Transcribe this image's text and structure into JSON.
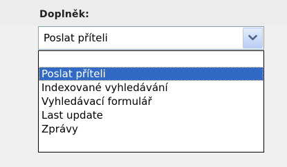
{
  "field": {
    "label": "Doplněk:",
    "selected_value": "Poslat příteli"
  },
  "dropdown": {
    "button_icon": "chevron-down-icon",
    "options": [
      {
        "label": "",
        "selected": false
      },
      {
        "label": "Poslat příteli",
        "selected": true
      },
      {
        "label": "Indexované vyhledávání",
        "selected": false
      },
      {
        "label": "Vyhledávací formulář",
        "selected": false
      },
      {
        "label": "Last update",
        "selected": false
      },
      {
        "label": "Zprávy",
        "selected": false
      }
    ]
  },
  "colors": {
    "selection_background": "#316ac5",
    "selection_text": "#ffffff",
    "panel_background": "#f0f0f0",
    "select_border": "#7f9db9"
  }
}
